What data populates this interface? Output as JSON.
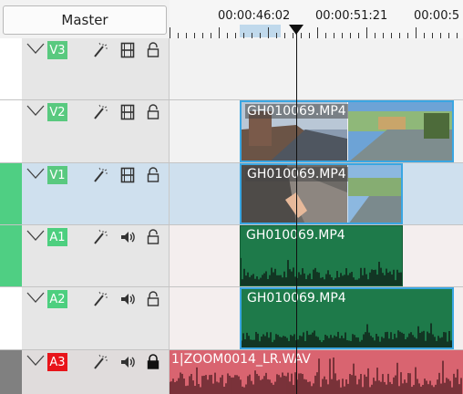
{
  "header": {
    "master_label": "Master"
  },
  "ruler": {
    "timecodes": [
      "00:00:46:02",
      "00:00:51:21",
      "00:00:5"
    ]
  },
  "colors": {
    "video_badge": "#59c97f",
    "audio_badge": "#4dcf7f",
    "locked_badge": "#e8141a",
    "audio_clip": "#1e7a4a",
    "selected_border": "#3aa6e2",
    "locked_clip": "#d96470"
  },
  "tracks": [
    {
      "name": "V3",
      "type": "video",
      "locked": false,
      "selected": false
    },
    {
      "name": "V2",
      "type": "video",
      "locked": false,
      "selected": false
    },
    {
      "name": "V1",
      "type": "video",
      "locked": false,
      "selected": true
    },
    {
      "name": "A1",
      "type": "audio",
      "locked": false,
      "selected": false
    },
    {
      "name": "A2",
      "type": "audio",
      "locked": false,
      "selected": false
    },
    {
      "name": "A3",
      "type": "audio",
      "locked": true,
      "selected": false
    }
  ],
  "clips": {
    "v2": "GH010069.MP4",
    "v1": "GH010069.MP4",
    "a1": "GH010069.MP4",
    "a2": "GH010069.MP4",
    "a3": "1|ZOOM0014_LR.WAV"
  },
  "icons": [
    "chevron-down-icon",
    "effects-wand-icon",
    "film-strip-icon",
    "speaker-icon",
    "lock-icon"
  ]
}
